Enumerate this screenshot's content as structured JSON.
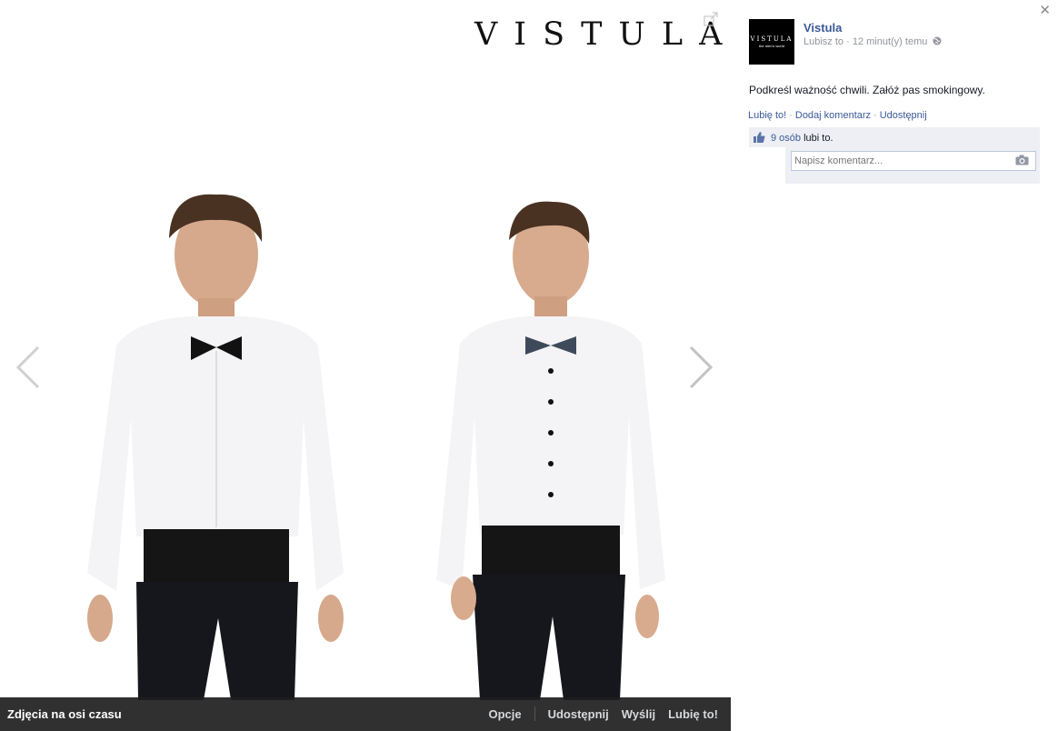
{
  "photo": {
    "brand_logo": "VISTULA",
    "album_title": "Zdjęcia na osi czasu",
    "actions": [
      "Opcje",
      "Udostępnij",
      "Wyślij",
      "Lubię to!"
    ]
  },
  "post": {
    "page_name": "Vistula",
    "avatar_text": "VISTULA",
    "avatar_subtext": "the men's world",
    "like_label": "Lubisz to",
    "separator": "·",
    "timestamp": "12 minut(y) temu",
    "caption": "Podkreśl ważność chwili. Załóż pas smokingowy.",
    "links": {
      "like": "Lubię to!",
      "comment": "Dodaj komentarz",
      "share": "Udostępnij"
    },
    "likes_count": "9 osób",
    "likes_suffix": "lubi to.",
    "comment_placeholder": "Napisz komentarz..."
  },
  "icons": {
    "close": "close-icon",
    "prev": "chevron-left-icon",
    "next": "chevron-right-icon",
    "expand": "expand-icon",
    "globe": "globe-icon",
    "thumb": "thumbs-up-icon",
    "camera": "camera-icon"
  },
  "colors": {
    "link": "#3b5998",
    "feedback_bg": "#edeff4",
    "photo_bar_bg": "#1e1e1e"
  }
}
